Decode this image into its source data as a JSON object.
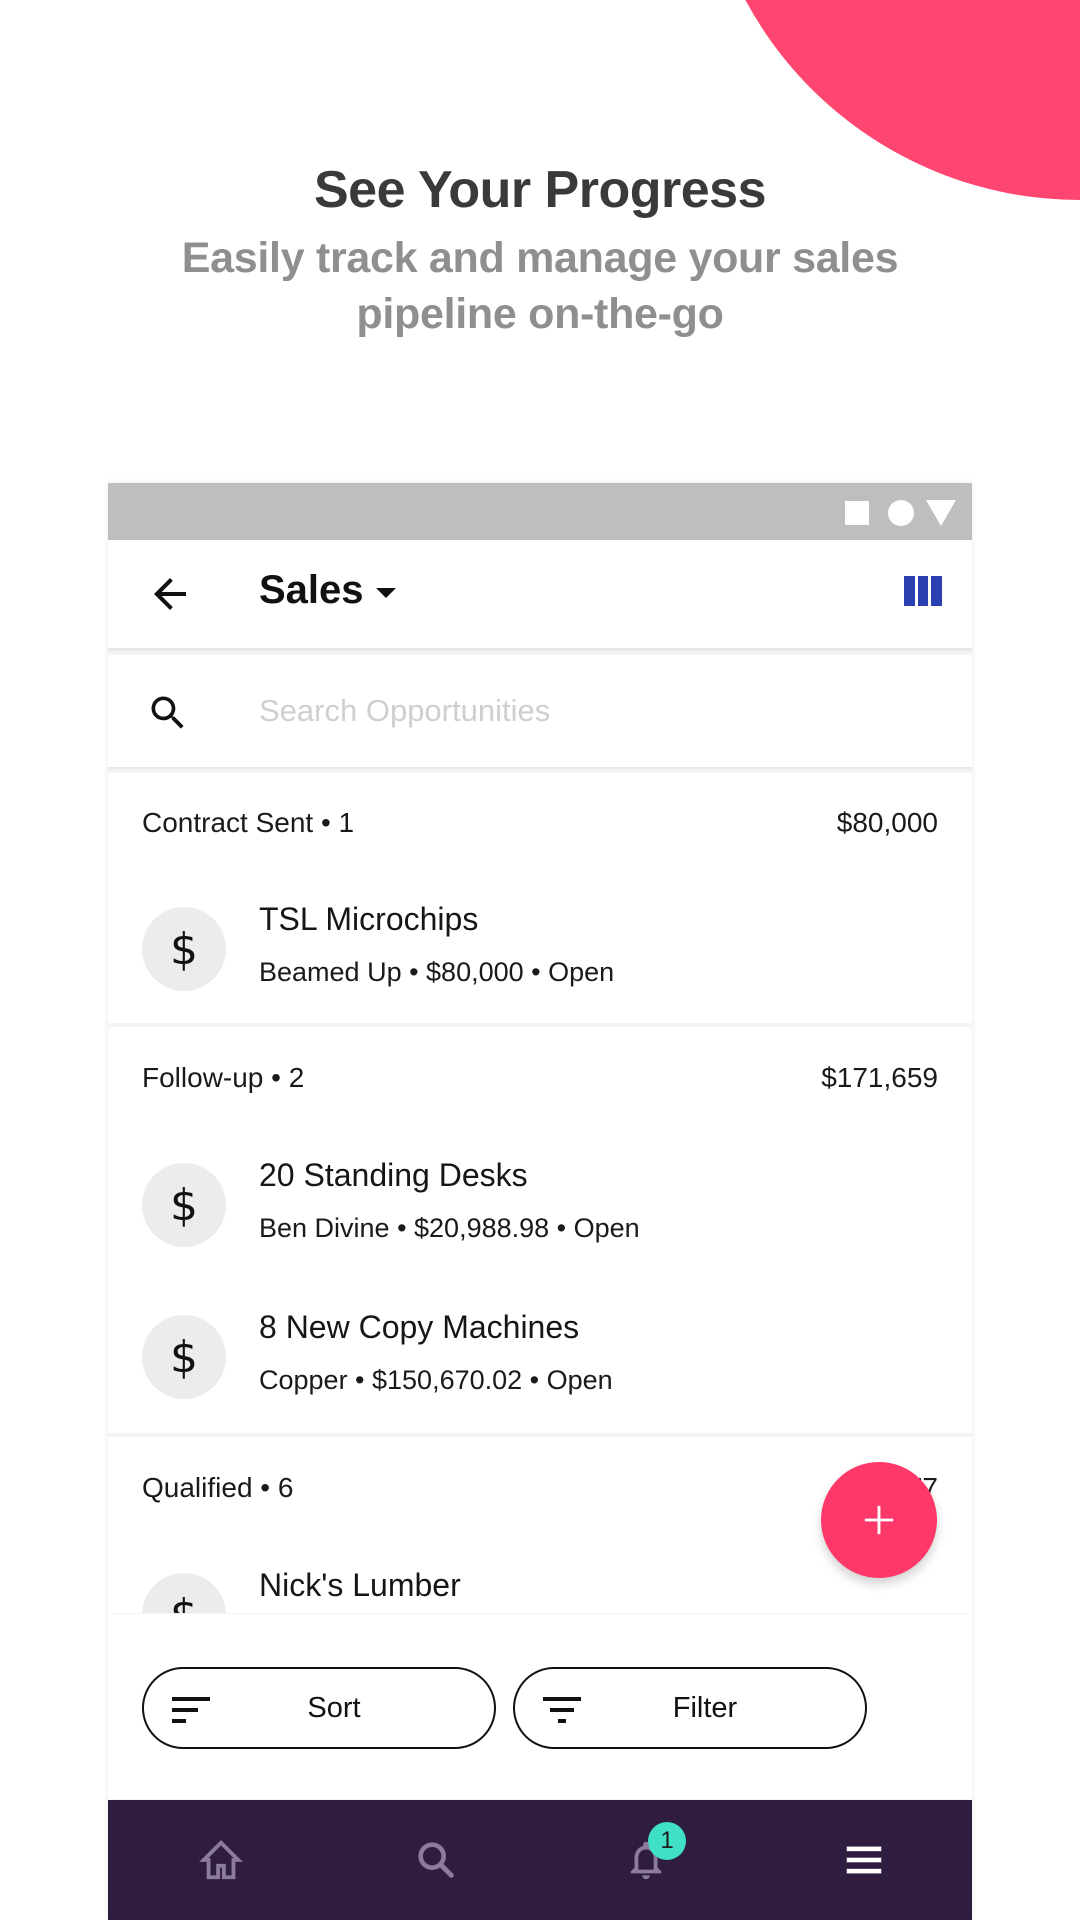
{
  "hero": {
    "title": "See Your Progress",
    "subtitle": "Easily track and manage your sales pipeline on-the-go"
  },
  "colors": {
    "accent_pink": "#fe4670",
    "fab": "#fe3868",
    "nav_bg": "#2e1d40",
    "badge": "#3fe0c5",
    "board_icon": "#2a3fb0"
  },
  "statusbar": {
    "icons": [
      "square-icon",
      "circle-icon",
      "triangle-icon"
    ]
  },
  "appbar": {
    "back_icon": "arrow-left-icon",
    "title": "Sales",
    "view_icon": "board-columns-icon"
  },
  "search": {
    "placeholder": "Search Opportunities",
    "value": ""
  },
  "sections": [
    {
      "name": "Contract Sent",
      "count": "1",
      "header": "Contract Sent • 1",
      "total": "$80,000",
      "items": [
        {
          "title": "TSL Microchips",
          "subtitle": "Beamed Up • $80,000 • Open",
          "icon": "dollar-icon"
        }
      ]
    },
    {
      "name": "Follow-up",
      "count": "2",
      "header": "Follow-up • 2",
      "total": "$171,659",
      "items": [
        {
          "title": "20 Standing Desks",
          "subtitle": "Ben Divine • $20,988.98 • Open",
          "icon": "dollar-icon"
        },
        {
          "title": "8 New Copy Machines",
          "subtitle": "Copper • $150,670.02 • Open",
          "icon": "dollar-icon"
        }
      ]
    },
    {
      "name": "Qualified",
      "count": "6",
      "header": "Qualified • 6",
      "total": "$1…77",
      "items": [
        {
          "title": "Nick's Lumber",
          "subtitle": "",
          "icon": "dollar-icon"
        }
      ]
    }
  ],
  "fab": {
    "icon": "plus-icon"
  },
  "actions": {
    "sort_label": "Sort",
    "filter_label": "Filter"
  },
  "bottom_nav": {
    "items": [
      {
        "name": "home",
        "icon": "home-icon"
      },
      {
        "name": "search",
        "icon": "search-icon"
      },
      {
        "name": "notifications",
        "icon": "bell-icon",
        "badge": "1"
      },
      {
        "name": "menu",
        "icon": "menu-icon"
      }
    ]
  }
}
